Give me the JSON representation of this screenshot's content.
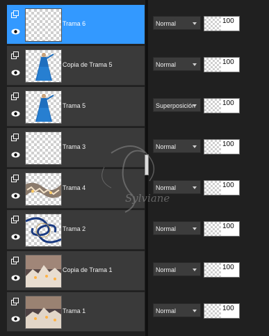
{
  "layers": [
    {
      "name": "Trama 6",
      "blend": "Normal",
      "opacity": "100",
      "selected": true,
      "thumb": "checker"
    },
    {
      "name": "Copia de Trama 5",
      "blend": "Normal",
      "opacity": "100",
      "selected": false,
      "thumb": "woman"
    },
    {
      "name": "Trama 5",
      "blend": "Superposición",
      "opacity": "100",
      "selected": false,
      "thumb": "woman"
    },
    {
      "name": "Trama 3",
      "blend": "Normal",
      "opacity": "100",
      "selected": false,
      "thumb": "checker"
    },
    {
      "name": "Trama 4",
      "blend": "Normal",
      "opacity": "100",
      "selected": false,
      "thumb": "winter-strip"
    },
    {
      "name": "Trama 2",
      "blend": "Normal",
      "opacity": "100",
      "selected": false,
      "thumb": "swirl"
    },
    {
      "name": "Copia de Trama 1",
      "blend": "Normal",
      "opacity": "100",
      "selected": false,
      "thumb": "winter-town"
    },
    {
      "name": "Trama 1",
      "blend": "Normal",
      "opacity": "100",
      "selected": false,
      "thumb": "winter-town"
    }
  ],
  "watermark": "Sylviane",
  "icons": {
    "group": "layer-stack-icon",
    "visibility": "eye-icon",
    "dropdown": "chevron-down-icon"
  },
  "colors": {
    "selected": "#3399ff",
    "row": "#3a3a3a",
    "background": "#202020"
  }
}
